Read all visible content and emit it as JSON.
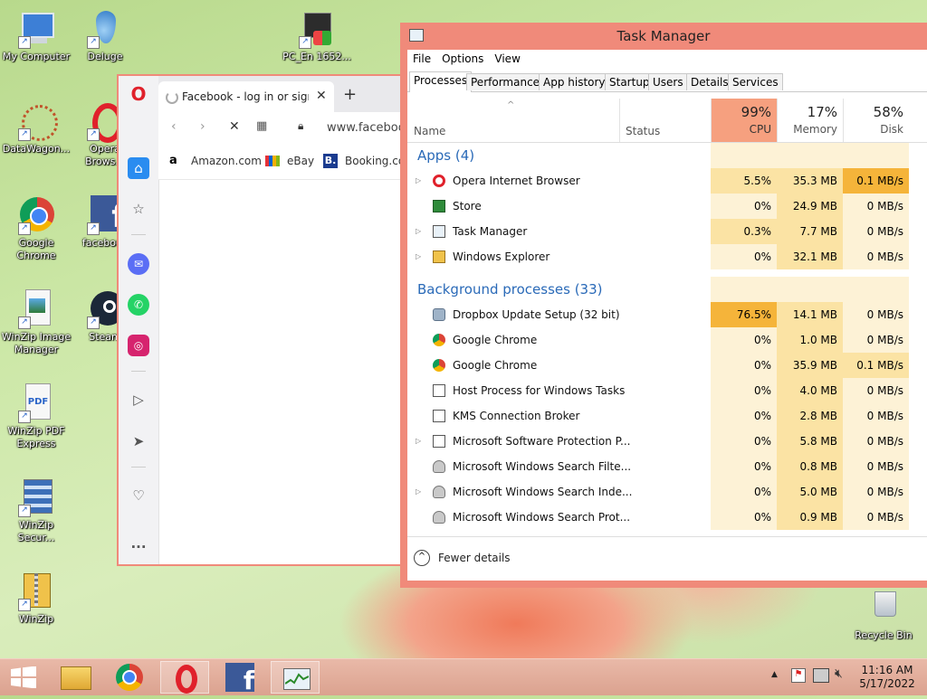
{
  "desktop": {
    "icons": [
      {
        "label": "My Computer",
        "icon": "computer-icon"
      },
      {
        "label": "Deluge",
        "icon": "deluge-icon"
      },
      {
        "label": "PC_En 1652...",
        "icon": "installer-icon"
      },
      {
        "label": "DataWagon...",
        "icon": "datawagon-icon"
      },
      {
        "label": "Opera Brows...",
        "icon": "opera-icon"
      },
      {
        "label": "Google Chrome",
        "icon": "chrome-icon"
      },
      {
        "label": "facebook",
        "icon": "facebook-icon"
      },
      {
        "label": "WinZip Image Manager",
        "icon": "winzip-image-icon"
      },
      {
        "label": "Steam",
        "icon": "steam-icon"
      },
      {
        "label": "WinZip PDF Express",
        "icon": "winzip-pdf-icon"
      },
      {
        "label": "WinZip Secur...",
        "icon": "winzip-secure-icon"
      },
      {
        "label": "WinZip",
        "icon": "winzip-icon"
      },
      {
        "label": "Recycle Bin",
        "icon": "recycle-bin-icon"
      }
    ]
  },
  "browser": {
    "tab_title": "Facebook - log in or sign u",
    "new_tab": "+",
    "address": "www.facebook",
    "bookmarks": [
      "Amazon.com",
      "eBay",
      "Booking.com"
    ],
    "sidebar_more": "..."
  },
  "task_manager": {
    "title": "Task Manager",
    "menu": [
      "File",
      "Options",
      "View"
    ],
    "tabs": [
      "Processes",
      "Performance",
      "App history",
      "Startup",
      "Users",
      "Details",
      "Services"
    ],
    "active_tab": "Processes",
    "columns": {
      "name": "Name",
      "status": "Status",
      "cpu": {
        "pct": "99%",
        "label": "CPU"
      },
      "memory": {
        "pct": "17%",
        "label": "Memory"
      },
      "disk": {
        "pct": "58%",
        "label": "Disk"
      }
    },
    "groups": {
      "apps": "Apps (4)",
      "background": "Background processes (33)"
    },
    "apps": [
      {
        "name": "Opera Internet Browser",
        "cpu": "5.5%",
        "memory": "35.3 MB",
        "disk": "0.1 MB/s",
        "expandable": true,
        "icon": "opera-icon"
      },
      {
        "name": "Store",
        "cpu": "0%",
        "memory": "24.9 MB",
        "disk": "0 MB/s",
        "expandable": false,
        "icon": "store-icon"
      },
      {
        "name": "Task Manager",
        "cpu": "0.3%",
        "memory": "7.7 MB",
        "disk": "0 MB/s",
        "expandable": true,
        "icon": "task-manager-icon"
      },
      {
        "name": "Windows Explorer",
        "cpu": "0%",
        "memory": "32.1 MB",
        "disk": "0 MB/s",
        "expandable": true,
        "icon": "folder-icon"
      }
    ],
    "background": [
      {
        "name": "Dropbox Update Setup (32 bit)",
        "cpu": "76.5%",
        "memory": "14.1 MB",
        "disk": "0 MB/s",
        "expandable": false,
        "icon": "dropbox-icon"
      },
      {
        "name": "Google Chrome",
        "cpu": "0%",
        "memory": "1.0 MB",
        "disk": "0 MB/s",
        "expandable": false,
        "icon": "chrome-icon"
      },
      {
        "name": "Google Chrome",
        "cpu": "0%",
        "memory": "35.9 MB",
        "disk": "0.1 MB/s",
        "expandable": false,
        "icon": "chrome-icon"
      },
      {
        "name": "Host Process for Windows Tasks",
        "cpu": "0%",
        "memory": "4.0 MB",
        "disk": "0 MB/s",
        "expandable": false,
        "icon": "window-process-icon"
      },
      {
        "name": "KMS Connection Broker",
        "cpu": "0%",
        "memory": "2.8 MB",
        "disk": "0 MB/s",
        "expandable": false,
        "icon": "window-process-icon"
      },
      {
        "name": "Microsoft Software Protection P...",
        "cpu": "0%",
        "memory": "5.8 MB",
        "disk": "0 MB/s",
        "expandable": true,
        "icon": "window-process-icon"
      },
      {
        "name": "Microsoft Windows Search Filte...",
        "cpu": "0%",
        "memory": "0.8 MB",
        "disk": "0 MB/s",
        "expandable": false,
        "icon": "search-user-icon"
      },
      {
        "name": "Microsoft Windows Search Inde...",
        "cpu": "0%",
        "memory": "5.0 MB",
        "disk": "0 MB/s",
        "expandable": true,
        "icon": "search-user-icon"
      },
      {
        "name": "Microsoft Windows Search Prot...",
        "cpu": "0%",
        "memory": "0.9 MB",
        "disk": "0 MB/s",
        "expandable": false,
        "icon": "search-user-icon"
      }
    ],
    "fewer_details": "Fewer details"
  },
  "taskbar": {
    "time": "11:16 AM",
    "date": "5/17/2022"
  },
  "colors": {
    "accent": "#f08a7a",
    "cpu_high": "#f5b43a",
    "cpu_med": "#fbe3a4",
    "cell_light": "#fdf2d6",
    "group_blue": "#2a6ab8"
  }
}
